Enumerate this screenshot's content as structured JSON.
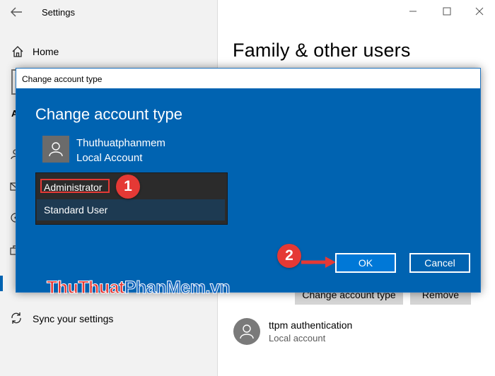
{
  "settings": {
    "app_title": "Settings",
    "home_label": "Home",
    "section_stub": "A",
    "sync_label": "Sync your settings"
  },
  "right": {
    "page_title": "Family & other users",
    "change_account_type_label": "Change account type",
    "remove_label": "Remove",
    "user": {
      "name": "ttpm authentication",
      "sub": "Local account"
    }
  },
  "dialog": {
    "titlebar": "Change account type",
    "heading": "Change account type",
    "account_name": "Thuthuatphanmem",
    "account_type": "Local Account",
    "options": [
      "Administrator",
      "Standard User"
    ],
    "selected": "Administrator",
    "ok_label": "OK",
    "cancel_label": "Cancel"
  },
  "annotations": {
    "step1": "1",
    "step2": "2",
    "color": "#e53935"
  },
  "watermark": {
    "part1": "ThuThuat",
    "part2": "PhanMem",
    "part3": ".vn"
  },
  "colors": {
    "dialog_bg": "#0063b1",
    "accent": "#0078d7"
  }
}
